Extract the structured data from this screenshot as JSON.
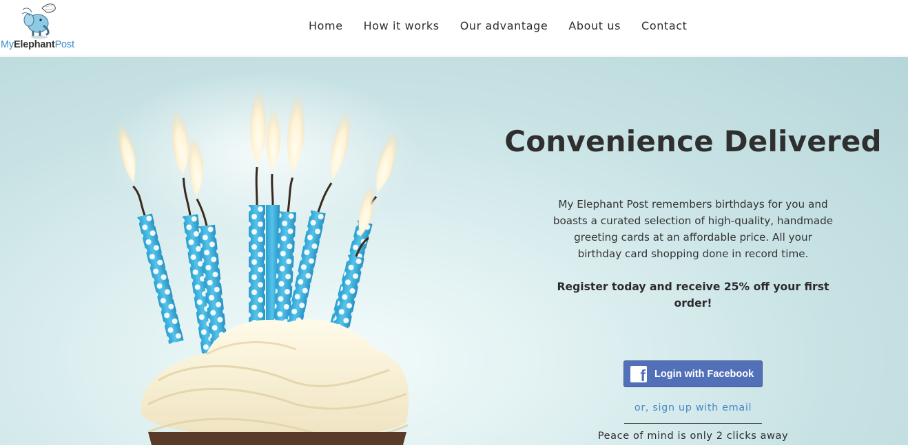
{
  "header": {
    "logo": {
      "my": "My",
      "elephant": "Elephant",
      "post": "Post",
      "icon": "flying-elephant-mascot"
    },
    "nav": [
      {
        "label": "Home"
      },
      {
        "label": "How it works"
      },
      {
        "label": "Our advantage"
      },
      {
        "label": "About us"
      },
      {
        "label": "Contact"
      }
    ]
  },
  "hero": {
    "image": "birthday-cupcake-with-blue-polka-dot-candles",
    "headline": "Convenience Delivered",
    "intro": "My Elephant Post remembers birthdays for you and boasts a curated selection of high-quality, handmade greeting cards at an affordable price. All your birthday card shopping done in record time.",
    "promo": "Register today and receive 25% off your first order!",
    "facebook_button": {
      "icon": "facebook-icon",
      "icon_glyph": "f",
      "label": "Login with Facebook"
    },
    "email_link": "or, sign up with email",
    "tagline": "Peace of mind is only 2 clicks away"
  },
  "colors": {
    "brand_blue": "#3a8fc9",
    "facebook_blue": "#5270b8",
    "link_blue": "#4a88c6",
    "text_dark": "#2f2f2f",
    "hero_background": "#c9e3e5"
  }
}
